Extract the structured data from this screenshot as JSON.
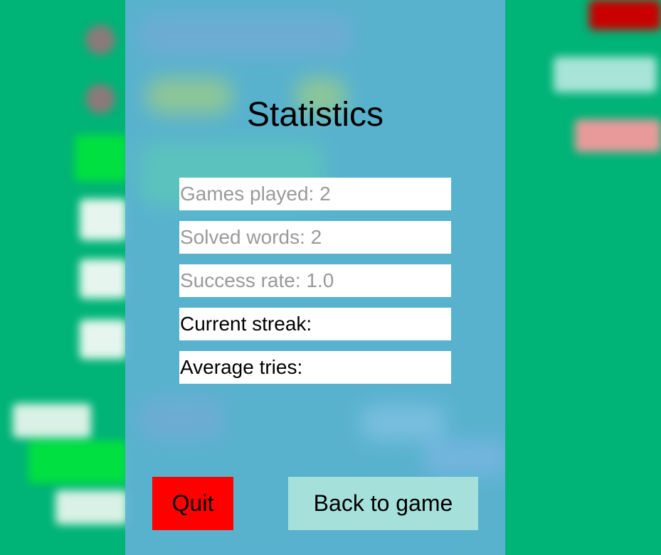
{
  "modal": {
    "title": "Statistics",
    "stats": [
      {
        "label": "Games played: 2"
      },
      {
        "label": "Solved words: 2"
      },
      {
        "label": "Success rate: 1.0"
      },
      {
        "label": "Current streak:"
      },
      {
        "label": "Average tries:"
      }
    ],
    "buttons": {
      "quit_label": "Quit",
      "back_label": "Back to game"
    }
  },
  "colors": {
    "background": "#00b377",
    "panel": "#60b2d6",
    "quit_button": "#ff0000",
    "back_button": "#a6e0da",
    "dim_text": "#9a9a9a"
  }
}
